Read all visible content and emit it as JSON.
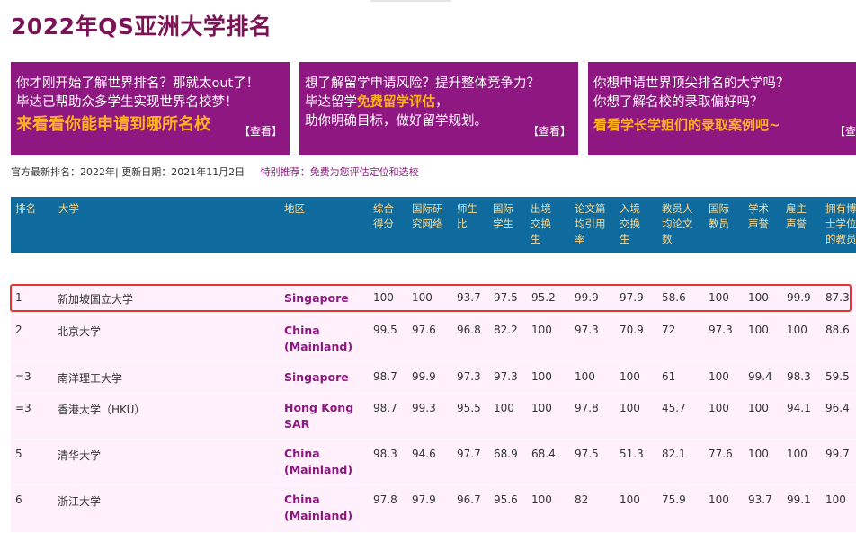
{
  "page_title": "2022年QS亚洲大学排名",
  "banners": [
    {
      "line1": "你才刚开始了解世界排名？那就太out了！",
      "line2": "毕达已帮助众多学生实现世界名校梦！",
      "line3": "来看看你能申请到哪所名校",
      "more": "【查看】"
    },
    {
      "line1": "想了解留学申请风险？提升整体竞争力？",
      "line2_prefix": "毕达留学",
      "line2_highlight": "免费留学评估",
      "line2_suffix": "，",
      "line3": "助你明确目标，做好留学规划。",
      "more": "【查看】"
    },
    {
      "line1": "你想申请世界顶尖排名的大学吗？",
      "line2": "你想了解名校的录取偏好吗？",
      "line3": "看看学长学姐们的录取案例吧~",
      "more": "【查看】"
    }
  ],
  "info": {
    "text": "官方最新排名：2022年| 更新日期：2021年11月2日",
    "rec_label": "特别推荐：",
    "rec_link": "免费为您评估定位和选校"
  },
  "headers": [
    "排名",
    "大学",
    "地区",
    "综合得分",
    "国际研究网络",
    "师生比",
    "国际学生",
    "出境交换生",
    "论文篇均引用率",
    "入境交换生",
    "教员人均论文数",
    "国际教员",
    "学术声誉",
    "雇主声誉",
    "拥有博士学位的教员"
  ],
  "rows": [
    {
      "rank": "1",
      "name": "新加坡国立大学",
      "region": [
        "Singapore"
      ],
      "scores": [
        "100",
        "100",
        "93.7",
        "97.5",
        "95.2",
        "99.9",
        "97.9",
        "58.6",
        "100",
        "100",
        "99.9",
        "87.3"
      ]
    },
    {
      "rank": "2",
      "name": "北京大学",
      "region": [
        "China",
        "(Mainland)"
      ],
      "scores": [
        "99.5",
        "97.6",
        "96.8",
        "82.2",
        "100",
        "97.3",
        "70.9",
        "72",
        "97.3",
        "100",
        "100",
        "88.6"
      ]
    },
    {
      "rank": "=3",
      "name": "南洋理工大学",
      "region": [
        "Singapore"
      ],
      "scores": [
        "98.7",
        "99.9",
        "97.3",
        "97.3",
        "100",
        "100",
        "100",
        "61",
        "100",
        "99.4",
        "98.3",
        "59.5"
      ]
    },
    {
      "rank": "=3",
      "name": "香港大学（HKU）",
      "region": [
        "Hong Kong",
        "SAR"
      ],
      "scores": [
        "98.7",
        "99.3",
        "95.5",
        "100",
        "100",
        "97.8",
        "100",
        "45.7",
        "100",
        "100",
        "94.1",
        "96.4"
      ]
    },
    {
      "rank": "5",
      "name": "清华大学",
      "region": [
        "China",
        "(Mainland)"
      ],
      "scores": [
        "98.3",
        "94.6",
        "97.7",
        "68.9",
        "68.4",
        "97.5",
        "51.3",
        "82.1",
        "77.6",
        "100",
        "100",
        "99.7"
      ]
    },
    {
      "rank": "6",
      "name": "浙江大学",
      "region": [
        "China",
        "(Mainland)"
      ],
      "scores": [
        "97.8",
        "97.9",
        "96.7",
        "95.6",
        "100",
        "82",
        "100",
        "75.9",
        "100",
        "93.7",
        "99.1",
        "100"
      ]
    }
  ]
}
